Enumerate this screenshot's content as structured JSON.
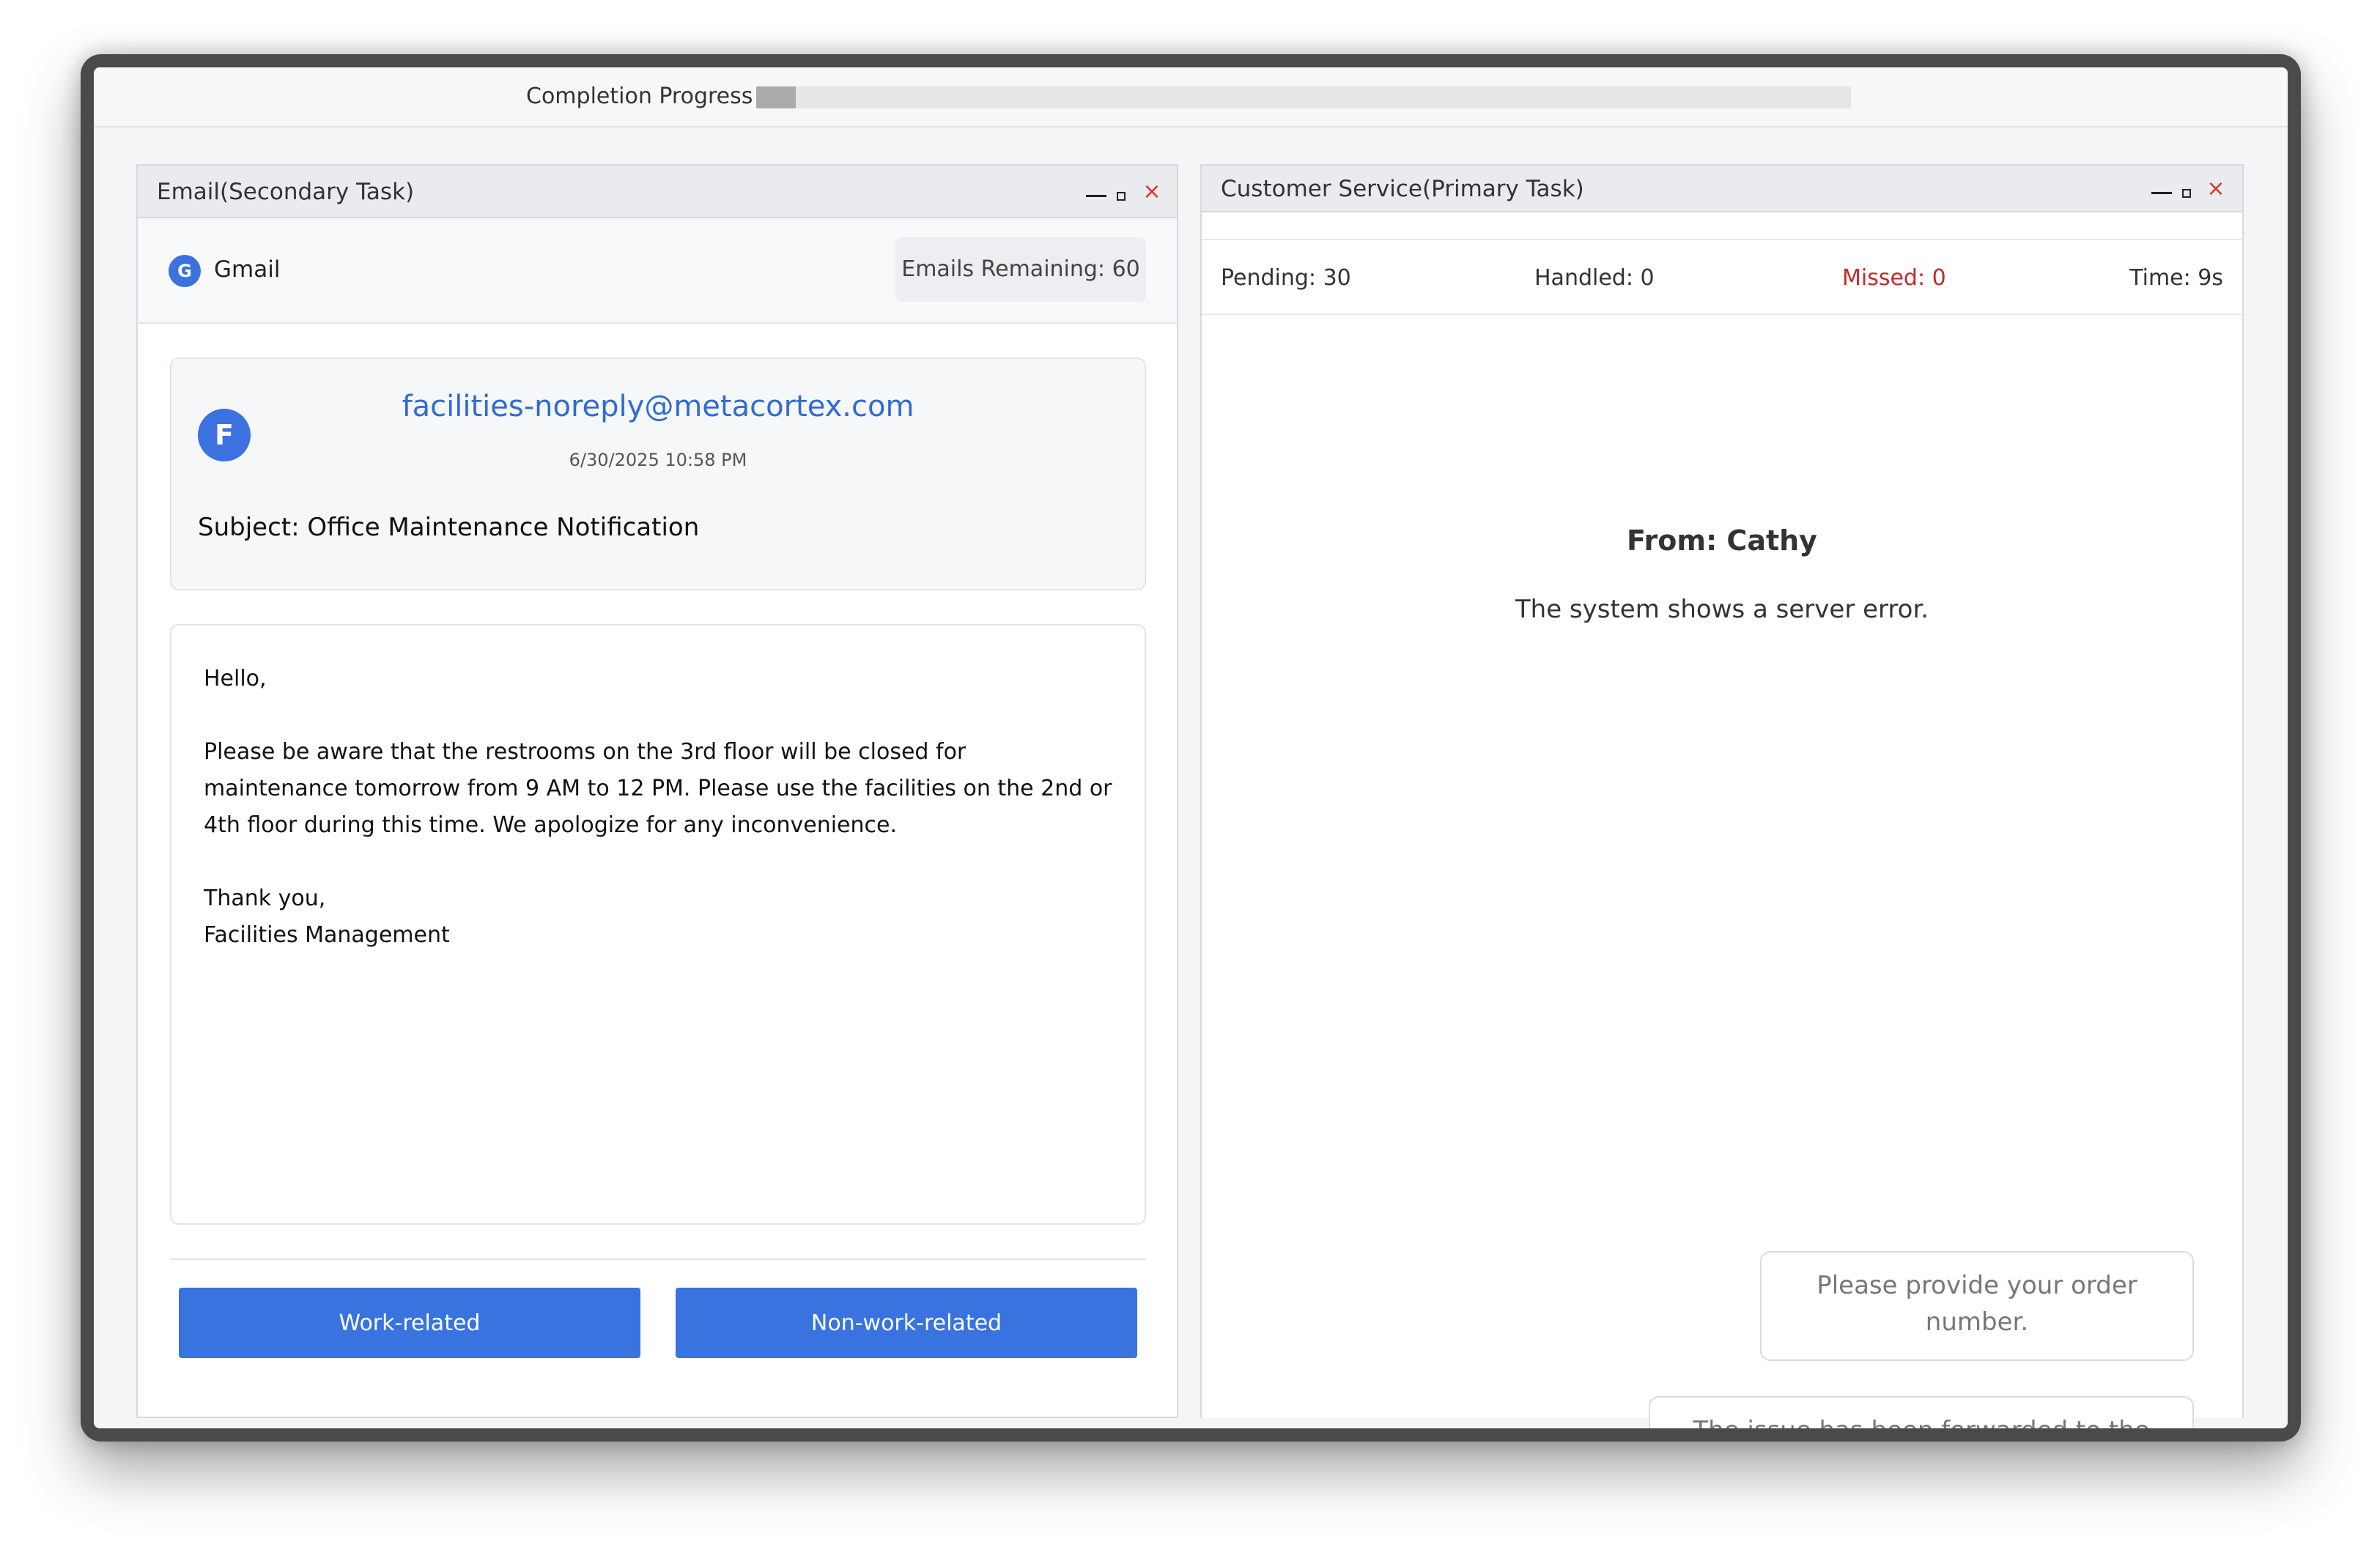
{
  "progress": {
    "label": "Completion Progress",
    "value_fraction": 0.036
  },
  "email_panel": {
    "title": "Email(Secondary Task)",
    "app_logo_letter": "G",
    "app_name": "Gmail",
    "emails_remaining": "Emails Remaining: 60",
    "email": {
      "avatar_letter": "F",
      "sender": "facilities-noreply@metacortex.com",
      "date": "6/30/2025 10:58 PM",
      "subject": "Subject: Office Maintenance Notification",
      "body": {
        "greeting": "Hello,",
        "paragraph": "Please be aware that the restrooms on the 3rd floor will be closed for maintenance tomorrow from 9 AM to 12 PM. Please use the facilities on the 2nd or 4th floor during this time. We apologize for any inconvenience.",
        "closing": "Thank you,",
        "signature": "Facilities Management"
      }
    },
    "buttons": {
      "work": "Work-related",
      "nonwork": "Non-work-related"
    }
  },
  "cs_panel": {
    "title": "Customer Service(Primary Task)",
    "stats": {
      "pending": "Pending: 30",
      "handled": "Handled: 0",
      "missed": "Missed: 0",
      "time": "Time: 9s"
    },
    "from": "From: Cathy",
    "message": "The system shows a server error.",
    "replies": [
      "Please provide your order number.",
      "The issue has been forwarded to the technical department."
    ]
  },
  "window_controls": {
    "minimize": "—",
    "close": "×"
  },
  "colors": {
    "accent": "#3873e0",
    "link": "#2f6bd6",
    "missed": "#c62828",
    "close": "#dd3333"
  },
  "icons": {
    "minimize": "minimize-icon",
    "maximize": "maximize-icon",
    "close": "close-icon"
  }
}
